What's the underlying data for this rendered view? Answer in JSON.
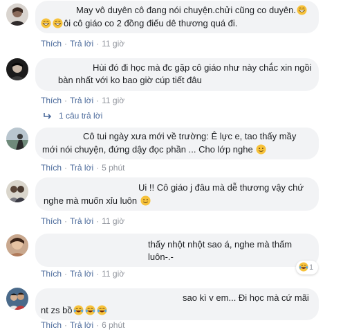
{
  "comments": [
    {
      "line1": "May vô duyên cô đang nói chuyện.chửi cũng co duyên.",
      "line2": "ôi cô giáo co 2 đồng điếu dê thương quá đi.",
      "like": "Thích",
      "reply": "Trả lời",
      "time": "11 giờ"
    },
    {
      "line1": "Hùi đó đi học mà đc gặp cô giáo như này chắc xin ngồi",
      "line2": "bàn nhất với ko bao giờ cúp tiết đâu",
      "like": "Thích",
      "reply": "Trả lời",
      "time": "11 giờ",
      "reply_count": "1 câu trả lời"
    },
    {
      "line1": "Cô tui ngày xưa mới về trường: Ê lực e, tao thấy mầy",
      "line2": "mới nói chuyện, đứng dậy đọc phần ... Cho lớp nghe",
      "like": "Thích",
      "reply": "Trả lời",
      "time": "5 phút"
    },
    {
      "line1": "Ui !! Cô giáo j đâu mà dễ thương vậy chứ",
      "line2": "nghe mà muốn xỉu luôn",
      "like": "Thích",
      "reply": "Trả lời",
      "time": "11 giờ"
    },
    {
      "line1": "thấy nhột nhột sao á, nghe mà thấm",
      "line2": "luôn-.-",
      "like": "Thích",
      "reply": "Trả lời",
      "time": "11 giờ",
      "reaction_count": "1"
    },
    {
      "line1": "sao kì v em... Đi học mà cứ mãi",
      "line2": "nt zs bồ",
      "like": "Thích",
      "reply": "Trả lời",
      "time": "6 phút"
    }
  ],
  "icons": {
    "grin": "grinning-sweat-emoji",
    "smile": "smiling-emoji",
    "laugh": "tears-of-joy-emoji",
    "reply_arrow": "reply-arrow-icon"
  },
  "colors": {
    "bubble": "#f2f3f5",
    "link": "#4b6a9b",
    "meta": "#90949c",
    "emoji": "#f7c23b"
  }
}
